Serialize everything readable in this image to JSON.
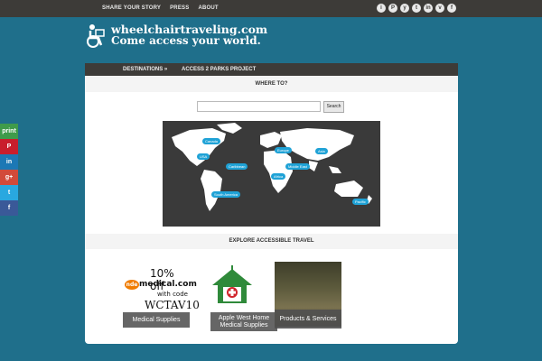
{
  "topnav": [
    "SHARE YOUR STORY",
    "PRESS",
    "ABOUT"
  ],
  "social_top": [
    "i",
    "P",
    "y",
    "t",
    "in",
    "v",
    "f"
  ],
  "logo": {
    "line1": "wheelchairtraveling.com",
    "line2": "Come access your world."
  },
  "mainnav": {
    "destinations": "DESTINATIONS »",
    "parks": "ACCESS 2 PARKS PROJECT"
  },
  "where_to": {
    "title": "WHERE TO?",
    "search_value": "",
    "search_button": "Search"
  },
  "map_pins": [
    "Canada",
    "USA",
    "Caribbean",
    "Europe",
    "Asia",
    "Middle East",
    "Africa",
    "South America",
    "Pacific"
  ],
  "explore": {
    "title": "EXPLORE ACCESSIBLE TRAVEL"
  },
  "promo": {
    "line1": "10% off",
    "badge": "nde",
    "brand": "medical.com",
    "line3": "with code",
    "code": "WCTAV10"
  },
  "tiles": [
    {
      "label": "Medical Supplies"
    },
    {
      "label": "Apple West Home Medical Supplies"
    },
    {
      "label": "Products & Services"
    }
  ],
  "side_share": [
    "print",
    "P",
    "in",
    "g+",
    "t",
    "f"
  ],
  "colors": {
    "background": "#1f6f8b",
    "bar": "#3d3b38",
    "pin": "#1fa2d6",
    "label_bg": "#666666"
  }
}
